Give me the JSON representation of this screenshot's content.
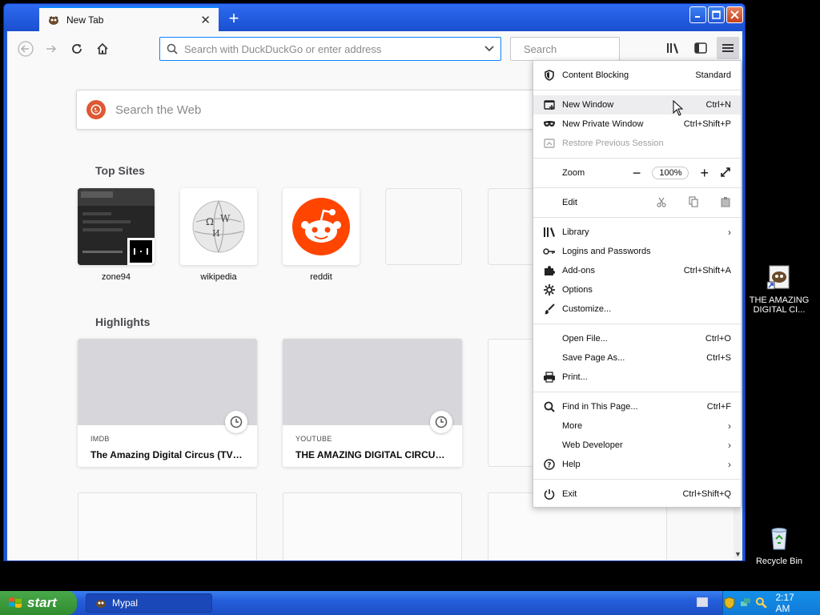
{
  "browser": {
    "tab_title": "New Tab",
    "url_placeholder": "Search with DuckDuckGo or enter address",
    "search_placeholder": "Search"
  },
  "newtab": {
    "web_search_placeholder": "Search the Web",
    "top_sites_title": "Top Sites",
    "top_sites": [
      {
        "label": "zone94"
      },
      {
        "label": "wikipedia"
      },
      {
        "label": "reddit"
      }
    ],
    "highlights_title": "Highlights",
    "highlights": [
      {
        "source": "IMDB",
        "title": "The Amazing Digital Circus (TV S..."
      },
      {
        "source": "YOUTUBE",
        "title": "THE AMAZING DIGITAL CIRCUS ..."
      }
    ]
  },
  "menu": {
    "content_blocking": {
      "label": "Content Blocking",
      "value": "Standard"
    },
    "new_window": {
      "label": "New Window",
      "shortcut": "Ctrl+N"
    },
    "new_private_window": {
      "label": "New Private Window",
      "shortcut": "Ctrl+Shift+P"
    },
    "restore_session": {
      "label": "Restore Previous Session"
    },
    "zoom": {
      "label": "Zoom",
      "value": "100%",
      "minus": "−",
      "plus": "+"
    },
    "edit": {
      "label": "Edit"
    },
    "library": {
      "label": "Library"
    },
    "logins": {
      "label": "Logins and Passwords"
    },
    "addons": {
      "label": "Add-ons",
      "shortcut": "Ctrl+Shift+A"
    },
    "options": {
      "label": "Options"
    },
    "customize": {
      "label": "Customize..."
    },
    "open_file": {
      "label": "Open File...",
      "shortcut": "Ctrl+O"
    },
    "save_page": {
      "label": "Save Page As...",
      "shortcut": "Ctrl+S"
    },
    "print": {
      "label": "Print..."
    },
    "find": {
      "label": "Find in This Page...",
      "shortcut": "Ctrl+F"
    },
    "more": {
      "label": "More"
    },
    "web_developer": {
      "label": "Web Developer"
    },
    "help": {
      "label": "Help"
    },
    "exit": {
      "label": "Exit",
      "shortcut": "Ctrl+Shift+Q"
    }
  },
  "desktop": {
    "icons": [
      {
        "label": "THE AMAZING DIGITAL CI..."
      },
      {
        "label": "Recycle Bin"
      }
    ]
  },
  "taskbar": {
    "start_label": "start",
    "task_label": "Mypal",
    "clock": "2:17 AM"
  },
  "colors": {
    "accent": "#0a84ff",
    "xp_blue": "#245edb",
    "start_green": "#3c9a3c",
    "ddg_orange": "#de5833",
    "reddit_orange": "#ff4500"
  }
}
